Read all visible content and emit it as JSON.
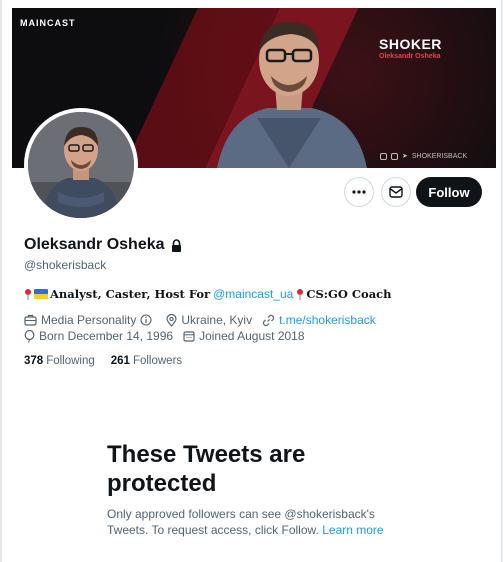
{
  "banner": {
    "logo_text": "MAINCAST",
    "title": "SHOKER",
    "subtitle": "Oleksandr Osheka",
    "socials_handle": "SHOKERISBACK"
  },
  "actions": {
    "more_icon": "ellipsis-icon",
    "message_icon": "mail-icon",
    "follow_label": "Follow"
  },
  "profile": {
    "name": "Oleksandr Osheka",
    "lock_icon": "lock-icon",
    "handle": "@shokerisback",
    "bio_role": "Analyst, Caster, Host For",
    "bio_mention": "@maincast_ua",
    "bio_coach": "CS:GO Coach",
    "category": "Media Personality",
    "location": "Ukraine, Kyiv",
    "website": "t.me/shokerisback",
    "born": "Born December 14, 1996",
    "joined": "Joined August 2018"
  },
  "stats": {
    "following_count": "378",
    "following_label": "Following",
    "followers_count": "261",
    "followers_label": "Followers"
  },
  "protected": {
    "title": "These Tweets are protected",
    "text": "Only approved followers can see @shokerisback's Tweets. To request access, click Follow.",
    "learn_more": "Learn more"
  },
  "colors": {
    "accent": "#1d9bf0",
    "text_primary": "#0f1419",
    "text_secondary": "#536471",
    "banner_red": "#8e1520"
  }
}
